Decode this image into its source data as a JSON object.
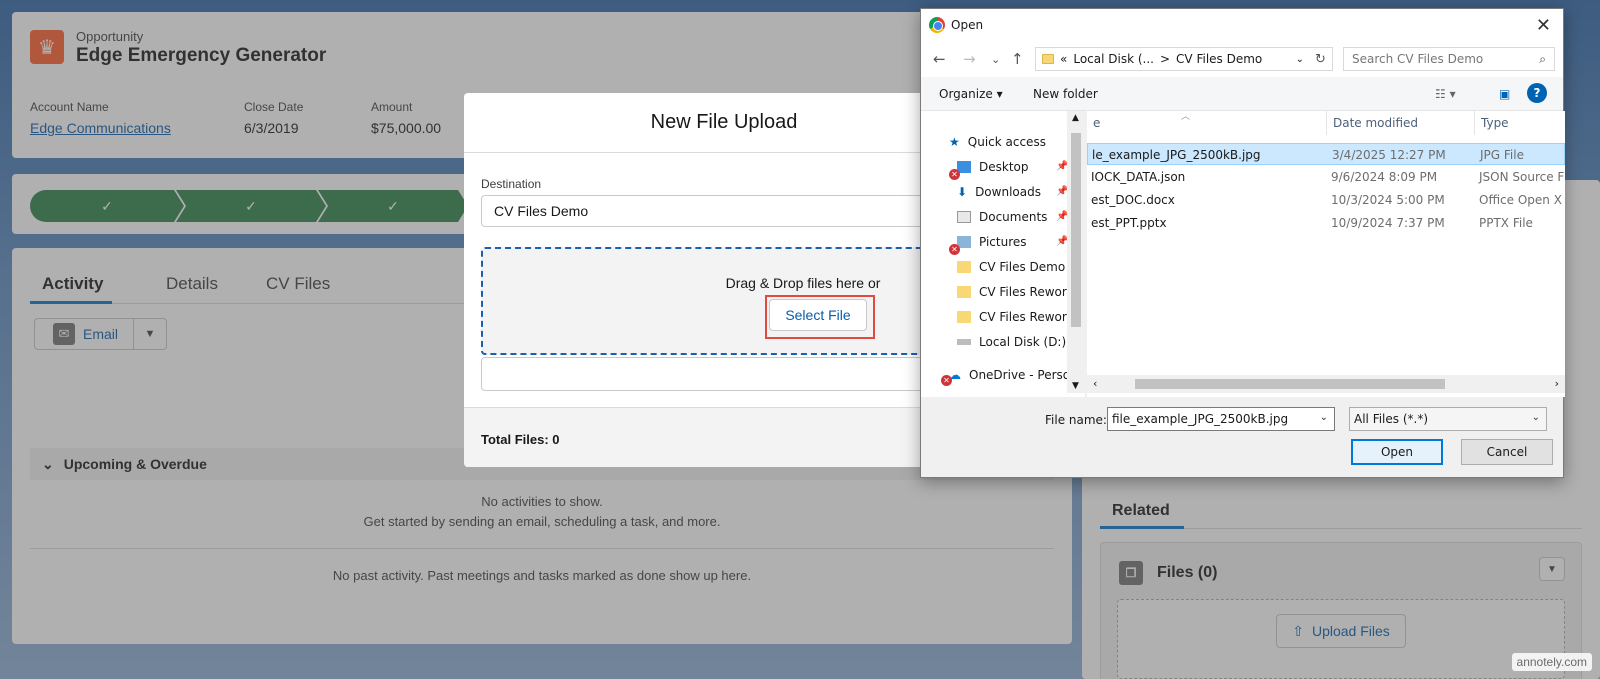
{
  "opportunity": {
    "kind": "Opportunity",
    "name": "Edge Emergency Generator",
    "fields": [
      {
        "label": "Account Name",
        "value": "Edge Communications"
      },
      {
        "label": "Close Date",
        "value": "6/3/2019"
      },
      {
        "label": "Amount",
        "value": "$75,000.00"
      }
    ]
  },
  "path": {
    "steps": [
      "✓",
      "✓",
      "✓"
    ]
  },
  "activity": {
    "tabs": [
      "Activity",
      "Details",
      "CV Files"
    ],
    "email_label": "Email",
    "upcoming_label": "Upcoming & Overdue",
    "no_activities": "No activities to show.",
    "get_started": "Get started by sending an email, scheduling a task, and more.",
    "no_past": "No past activity. Past meetings and tasks marked as done show up here."
  },
  "related": {
    "title": "Related",
    "files_title": "Files (0)",
    "upload_label": "Upload Files"
  },
  "watermark": "annotely.com",
  "modal": {
    "title": "New File Upload",
    "destination_label": "Destination",
    "destination_value": "CV Files Demo",
    "drop_text": "Drag & Drop files here or",
    "select_label": "Select File",
    "total_files": "Total Files: 0"
  },
  "dialog": {
    "title": "Open",
    "address": {
      "prefix": "«",
      "drive": "Local Disk (...",
      "sep": ">",
      "folder": "CV Files Demo"
    },
    "search_placeholder": "Search CV Files Demo",
    "organize": "Organize ▾",
    "new_folder": "New folder",
    "nav_items": [
      "Quick access",
      "Desktop",
      "Downloads",
      "Documents",
      "Pictures",
      "CV Files Demo",
      "CV Files Rewor",
      "CV Files Rework",
      "Local Disk (D:)",
      "OneDrive - Person"
    ],
    "columns": [
      "e",
      "Date modified",
      "Type"
    ],
    "files": [
      {
        "name": "le_example_JPG_2500kB.jpg",
        "date": "3/4/2025 12:27 PM",
        "type": "JPG File"
      },
      {
        "name": "IOCK_DATA.json",
        "date": "9/6/2024 8:09 PM",
        "type": "JSON Source F"
      },
      {
        "name": "est_DOC.docx",
        "date": "10/3/2024 5:00 PM",
        "type": "Office Open X"
      },
      {
        "name": "est_PPT.pptx",
        "date": "10/9/2024 7:37 PM",
        "type": "PPTX File"
      }
    ],
    "file_name_label": "File name:",
    "file_name_value": "file_example_JPG_2500kB.jpg",
    "file_type_value": "All Files (*.*)",
    "open_label": "Open",
    "cancel_label": "Cancel"
  },
  "colors": {
    "accent": "#0176d3",
    "path_green": "#2e844a",
    "opp_orange": "#ff5d2d",
    "highlight": "#e04a3f"
  }
}
